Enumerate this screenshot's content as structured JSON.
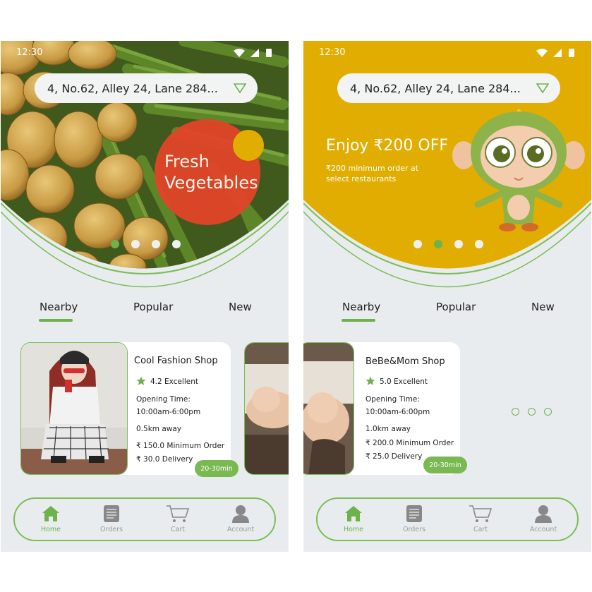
{
  "screens": [
    {
      "status_time": "12:30",
      "address": "4, No.62, Alley 24, Lane 284...",
      "hero": {
        "badge_line1": "Fresh",
        "badge_line2": "Vegetables",
        "active_dot": 0,
        "dot_count": 4
      },
      "tabs": [
        "Nearby",
        "Popular",
        "New"
      ],
      "active_tab": "Nearby",
      "shop": {
        "name": "Cool Fashion Shop",
        "rating": "4.2 Excellent",
        "opening_label": "Opening Time:",
        "opening_hours": "10:00am-6:00pm",
        "distance": "0.5km away",
        "min_order": "₹ 150.0 Minimum Order",
        "delivery": "₹ 30.0 Delivery",
        "eta": "20-30min"
      },
      "nav": [
        {
          "label": "Home",
          "icon": "home-icon",
          "active": true
        },
        {
          "label": "Orders",
          "icon": "orders-icon",
          "active": false
        },
        {
          "label": "Cart",
          "icon": "cart-icon",
          "active": false
        },
        {
          "label": "Account",
          "icon": "account-icon",
          "active": false
        }
      ]
    },
    {
      "status_time": "12:30",
      "address": "4, No.62, Alley 24, Lane 284...",
      "hero": {
        "promo_title": "Enjoy ₹200 OFF",
        "promo_line1": "₹200 minimum order at",
        "promo_line2": "select  restaurants",
        "active_dot": 1,
        "dot_count": 4
      },
      "tabs": [
        "Nearby",
        "Popular",
        "New"
      ],
      "active_tab": "Nearby",
      "shop": {
        "name": "BeBe&Mom Shop",
        "rating": "5.0 Excellent",
        "opening_label": "Opening Time:",
        "opening_hours": "10:00am-6:00pm",
        "distance": "1.0km away",
        "min_order": "₹ 200.0 Minimum Order",
        "delivery": "₹ 25.0 Delivery",
        "eta": "20-30min"
      },
      "nav": [
        {
          "label": "Home",
          "icon": "home-icon",
          "active": true
        },
        {
          "label": "Orders",
          "icon": "orders-icon",
          "active": false
        },
        {
          "label": "Cart",
          "icon": "cart-icon",
          "active": false
        },
        {
          "label": "Account",
          "icon": "account-icon",
          "active": false
        }
      ]
    }
  ],
  "colors": {
    "accent_green": "#6eb24c",
    "promo_yellow": "#e0ad00",
    "badge_red": "#e04528",
    "background": "#e9ecee"
  }
}
